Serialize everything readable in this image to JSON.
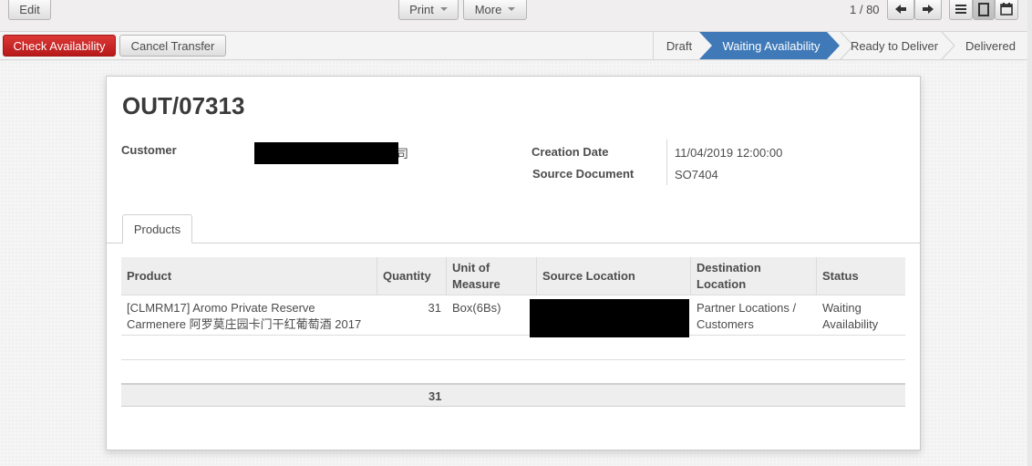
{
  "toolbar": {
    "edit_label": "Edit",
    "print_label": "Print",
    "more_label": "More",
    "pager": "1 / 80"
  },
  "actions": {
    "check_availability_label": "Check Availability",
    "cancel_transfer_label": "Cancel Transfer"
  },
  "status_stages": [
    {
      "label": "Draft",
      "active": false
    },
    {
      "label": "Waiting Availability",
      "active": true
    },
    {
      "label": "Ready to Deliver",
      "active": false
    },
    {
      "label": "Delivered",
      "active": false
    }
  ],
  "record": {
    "title": "OUT/07313",
    "customer_label": "Customer",
    "customer_value_visible_tail": "司",
    "creation_date_label": "Creation Date",
    "creation_date": "11/04/2019 12:00:00",
    "source_document_label": "Source Document",
    "source_document": "SO7404"
  },
  "tabs": [
    {
      "label": "Products"
    }
  ],
  "table": {
    "headers": [
      "Product",
      "Quantity",
      "Unit of\nMeasure",
      "Source Location",
      "Destination\nLocation",
      "Status"
    ],
    "rows": [
      {
        "product": "[CLMRM17] Aromo Private Reserve Carmenere 阿罗莫庄园卡门干红葡萄酒 2017",
        "quantity": "31",
        "uom": "Box(6Bs)",
        "source_location": "",
        "destination_location": "Partner Locations / Customers",
        "status": "Waiting Availability"
      }
    ],
    "total_quantity": "31"
  },
  "colors": {
    "primary_button": "#c81e1e",
    "active_stage": "#3f79b8",
    "background": "#f0eeee"
  }
}
